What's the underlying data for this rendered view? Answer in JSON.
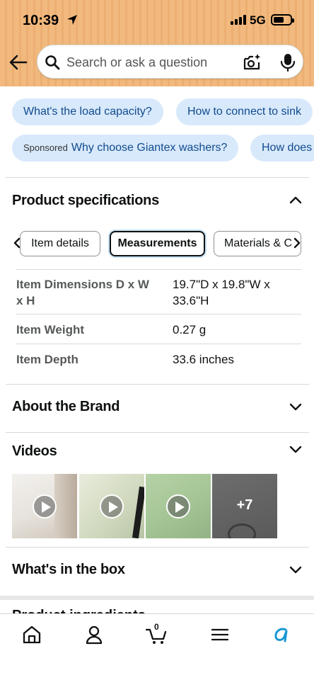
{
  "status_bar": {
    "time": "10:39",
    "network": "5G"
  },
  "search": {
    "placeholder": "Search or ask a question"
  },
  "chips": {
    "row1": [
      "What's the load capacity?",
      "How to connect to sink"
    ],
    "row2_sponsored_tag": "Sponsored",
    "row2": [
      "Why choose Giantex washers?",
      "How does"
    ]
  },
  "product_specifications": {
    "title": "Product specifications",
    "tabs": [
      "Item details",
      "Measurements",
      "Materials & C"
    ],
    "active_tab": "Measurements",
    "rows": [
      {
        "label": "Item Dimensions D x W x H",
        "value": "19.7\"D x 19.8\"W x 33.6\"H"
      },
      {
        "label": "Item Weight",
        "value": "0.27 g"
      },
      {
        "label": "Item Depth",
        "value": "33.6 inches"
      }
    ]
  },
  "about_brand": {
    "title": "About the Brand"
  },
  "videos": {
    "title": "Videos",
    "more_label": "+7"
  },
  "whats_in_box": {
    "title": "What's in the box"
  },
  "peek": {
    "title": "Product ingredients"
  },
  "bottom_nav": {
    "items": [
      "home-icon",
      "account-icon",
      "cart-icon",
      "menu-icon",
      "rufus-icon"
    ],
    "cart_count": "0"
  },
  "colors": {
    "header_bg": "#f2b97e",
    "chip_bg": "#d8e9fb",
    "chip_text": "#114b8f",
    "active_tab_ring": "#c4e0f3",
    "assistant_accent": "#1a98d5"
  }
}
